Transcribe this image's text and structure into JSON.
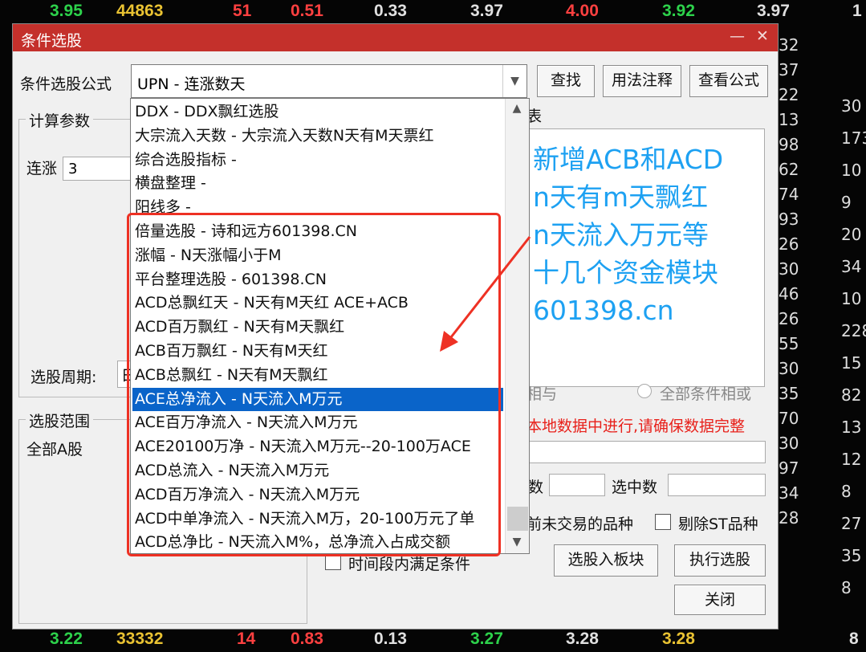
{
  "background": {
    "top_row": [
      "3.95",
      "44863",
      "51",
      "0.51",
      "0.33",
      "3.97",
      "4.00",
      "3.92",
      "3.97",
      "1"
    ],
    "bottom_row": [
      "3.22",
      "33332",
      "14",
      "0.83",
      "0.13",
      "3.27",
      "3.28",
      "3.28",
      "8"
    ],
    "right_col1": [
      "32",
      "37",
      "22",
      "13",
      "98",
      "62",
      "74",
      "93",
      "26",
      "30",
      "46",
      "26",
      "55",
      "30",
      "35",
      "70",
      "30",
      "97",
      "34",
      "28"
    ],
    "right_col2": [
      "30",
      "173",
      "10",
      "9",
      "20",
      "34",
      "10",
      "228",
      "15",
      "82",
      "13",
      "12",
      "8",
      "27",
      "35",
      "8"
    ]
  },
  "dialog": {
    "title": "条件选股",
    "minimize": "—",
    "close": "✕",
    "formula_label": "条件选股公式",
    "formula_value": "UPN           - 连涨数天",
    "btn_find": "查找",
    "btn_usage": "用法注释",
    "btn_view": "查看公式",
    "params_group": "计算参数",
    "param_label": "连涨",
    "param_value": "3",
    "period_label": "选股周期:",
    "period_value": "日",
    "range_group": "选股范围",
    "range_value": "全部A股",
    "hidden_tab": "表",
    "radio_label_a": "相与",
    "radio_label_b": "全部条件相或",
    "warning": "本地数据中进行,请确保数据完整",
    "count_label": "数",
    "selected_label": "选中数",
    "exclude_untraded": "前未交易的品种",
    "exclude_st": "剔除ST品种",
    "time_condition": "时间段内满足条件",
    "btn_to_block": "选股入板块",
    "btn_execute": "执行选股",
    "btn_close": "关闭"
  },
  "overlay_text": [
    "新增ACB和ACD",
    "n天有m天飘红",
    "n天流入万元等",
    "十几个资金模块",
    "601398.cn"
  ],
  "dropdown": {
    "items": [
      "DDX          - DDX飘红选股",
      "大宗流入天数 - 大宗流入天数N天有M天票红",
      "综合选股指标 -",
      "横盘整理      -",
      "阳线多         -",
      "倍量选股      - 诗和远方601398.CN",
      "涨幅            - N天涨幅小于M",
      "平台整理选股 - 601398.CN",
      "ACD总飘红天  - N天有M天红 ACE+ACB",
      "ACD百万飘红  - N天有M天飘红",
      "ACB百万飘红  - N天有M天红",
      "ACB总飘红     - N天有M天飘红",
      "ACE总净流入   - N天流入M万元",
      "ACE百万净流入 - N天流入M万元",
      "ACE20100万净 - N天流入M万元--20-100万ACE",
      "ACD总流入      - N天流入M万元",
      "ACD百万净流入 - N天流入M万元",
      "ACD中单净流入 - N天流入M万，20-100万元了单",
      "ACD总净比      - N天流入M%，总净流入占成交额"
    ],
    "selected_index": 12
  },
  "colors": {
    "accent": "#c4302b",
    "selection": "#0a64c9",
    "annotation": "#1da1f2",
    "highlight_box": "#ee3124"
  }
}
